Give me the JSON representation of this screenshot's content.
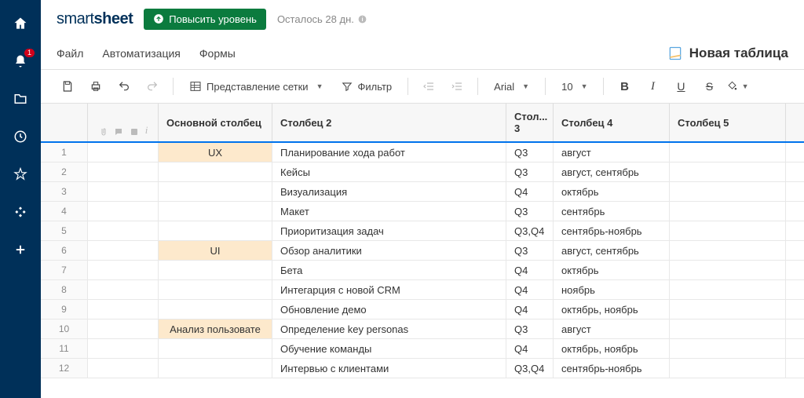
{
  "brand": {
    "part1": "smart",
    "part2": "sheet"
  },
  "upgrade_label": "Повысить уровень",
  "trial_text": "Осталось 28 дн.",
  "notification_badge": "1",
  "menu": {
    "file": "Файл",
    "automation": "Автоматизация",
    "forms": "Формы"
  },
  "sheet_title": "Новая таблица",
  "toolbar": {
    "view": "Представление сетки",
    "filter": "Фильтр",
    "font": "Arial",
    "size": "10"
  },
  "columns": [
    "Основной столбец",
    "Столбец 2",
    "Стол... 3",
    "Столбец 4",
    "Столбец 5"
  ],
  "rows": [
    {
      "n": "1",
      "c0": "UX",
      "hl": true,
      "c1": "Планирование хода работ",
      "c2": "Q3",
      "c3": "август"
    },
    {
      "n": "2",
      "c0": "",
      "hl": false,
      "c1": "Кейсы",
      "c2": "Q3",
      "c3": "август, сентябрь"
    },
    {
      "n": "3",
      "c0": "",
      "hl": false,
      "c1": "Визуализация",
      "c2": "Q4",
      "c3": "октябрь"
    },
    {
      "n": "4",
      "c0": "",
      "hl": false,
      "c1": "Макет",
      "c2": "Q3",
      "c3": "сентябрь"
    },
    {
      "n": "5",
      "c0": "",
      "hl": false,
      "c1": "Приоритизация задач",
      "c2": "Q3,Q4",
      "c3": "сентябрь-ноябрь"
    },
    {
      "n": "6",
      "c0": "UI",
      "hl": true,
      "c1": "Обзор аналитики",
      "c2": "Q3",
      "c3": "август, сентябрь"
    },
    {
      "n": "7",
      "c0": "",
      "hl": false,
      "c1": "Бета",
      "c2": "Q4",
      "c3": "октябрь"
    },
    {
      "n": "8",
      "c0": "",
      "hl": false,
      "c1": "Интегарция с новой CRM",
      "c2": "Q4",
      "c3": "ноябрь"
    },
    {
      "n": "9",
      "c0": "",
      "hl": false,
      "c1": "Обновление демо",
      "c2": "Q4",
      "c3": "октябрь, ноябрь"
    },
    {
      "n": "10",
      "c0": "Анализ пользовате",
      "hl": true,
      "c1": "Определение key personas",
      "c2": "Q3",
      "c3": "август"
    },
    {
      "n": "11",
      "c0": "",
      "hl": false,
      "c1": "Обучение команды",
      "c2": "Q4",
      "c3": "октябрь, ноябрь"
    },
    {
      "n": "12",
      "c0": "",
      "hl": false,
      "c1": "Интервью с клиентами",
      "c2": "Q3,Q4",
      "c3": "сентябрь-ноябрь"
    }
  ]
}
